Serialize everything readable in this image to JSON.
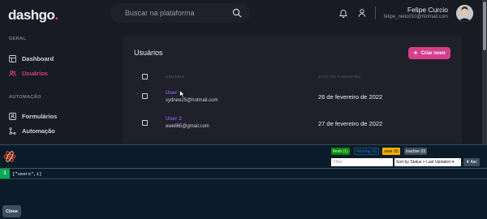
{
  "header": {
    "logo_text": "dashgo",
    "logo_dot": ".",
    "search_placeholder": "Buscar na plataforma",
    "user_name": "Felipe Curcio",
    "user_email": "felipe_nieto010@hotmail.com"
  },
  "sidebar": {
    "sections": [
      {
        "title": "GERAL",
        "items": [
          {
            "label": "Dashboard",
            "icon": "dashboard-icon",
            "active": false
          },
          {
            "label": "Usuários",
            "icon": "users-icon",
            "active": true
          }
        ]
      },
      {
        "title": "AUTOMAÇÃO",
        "items": [
          {
            "label": "Formulários",
            "icon": "form-icon",
            "active": false
          },
          {
            "label": "Automação",
            "icon": "git-merge-icon",
            "active": false
          }
        ]
      }
    ]
  },
  "main": {
    "title": "Usuários",
    "create_button": "Criar novo",
    "columns": {
      "user": "USUÁRIO",
      "created": "DATA DE CADASTRO"
    },
    "users": [
      {
        "name": "User 1",
        "email": "sydnee25@hotmail.com",
        "created": "26 de fevereiro de 2022"
      },
      {
        "name": "User 2",
        "email": "ewell65@gmail.com",
        "created": "27 de fevereiro de 2022"
      }
    ]
  },
  "devtools": {
    "badges": [
      {
        "label": "fresh (1)",
        "bg": "#008a00",
        "fg": "#ffffff"
      },
      {
        "label": "fetching (0)",
        "bg": "#0b1b29",
        "fg": "#0088ff"
      },
      {
        "label": "stale (0)",
        "bg": "#ffb200",
        "fg": "#111111"
      },
      {
        "label": "inactive (0)",
        "bg": "#3f4e60",
        "fg": "#ffffff"
      }
    ],
    "filter_placeholder": "Filter",
    "sort_value": "Sort by Status > Last Updated",
    "asc_label": "⬆ Asc",
    "queries": [
      {
        "count": "1",
        "key": "[\"users\",1]"
      }
    ],
    "close_label": "Close"
  },
  "colors": {
    "accent": "#d53f8c",
    "purple": "#805ad5",
    "bg": "#181b23",
    "card": "#1f2029",
    "devtools_bg": "#0b1b29"
  }
}
